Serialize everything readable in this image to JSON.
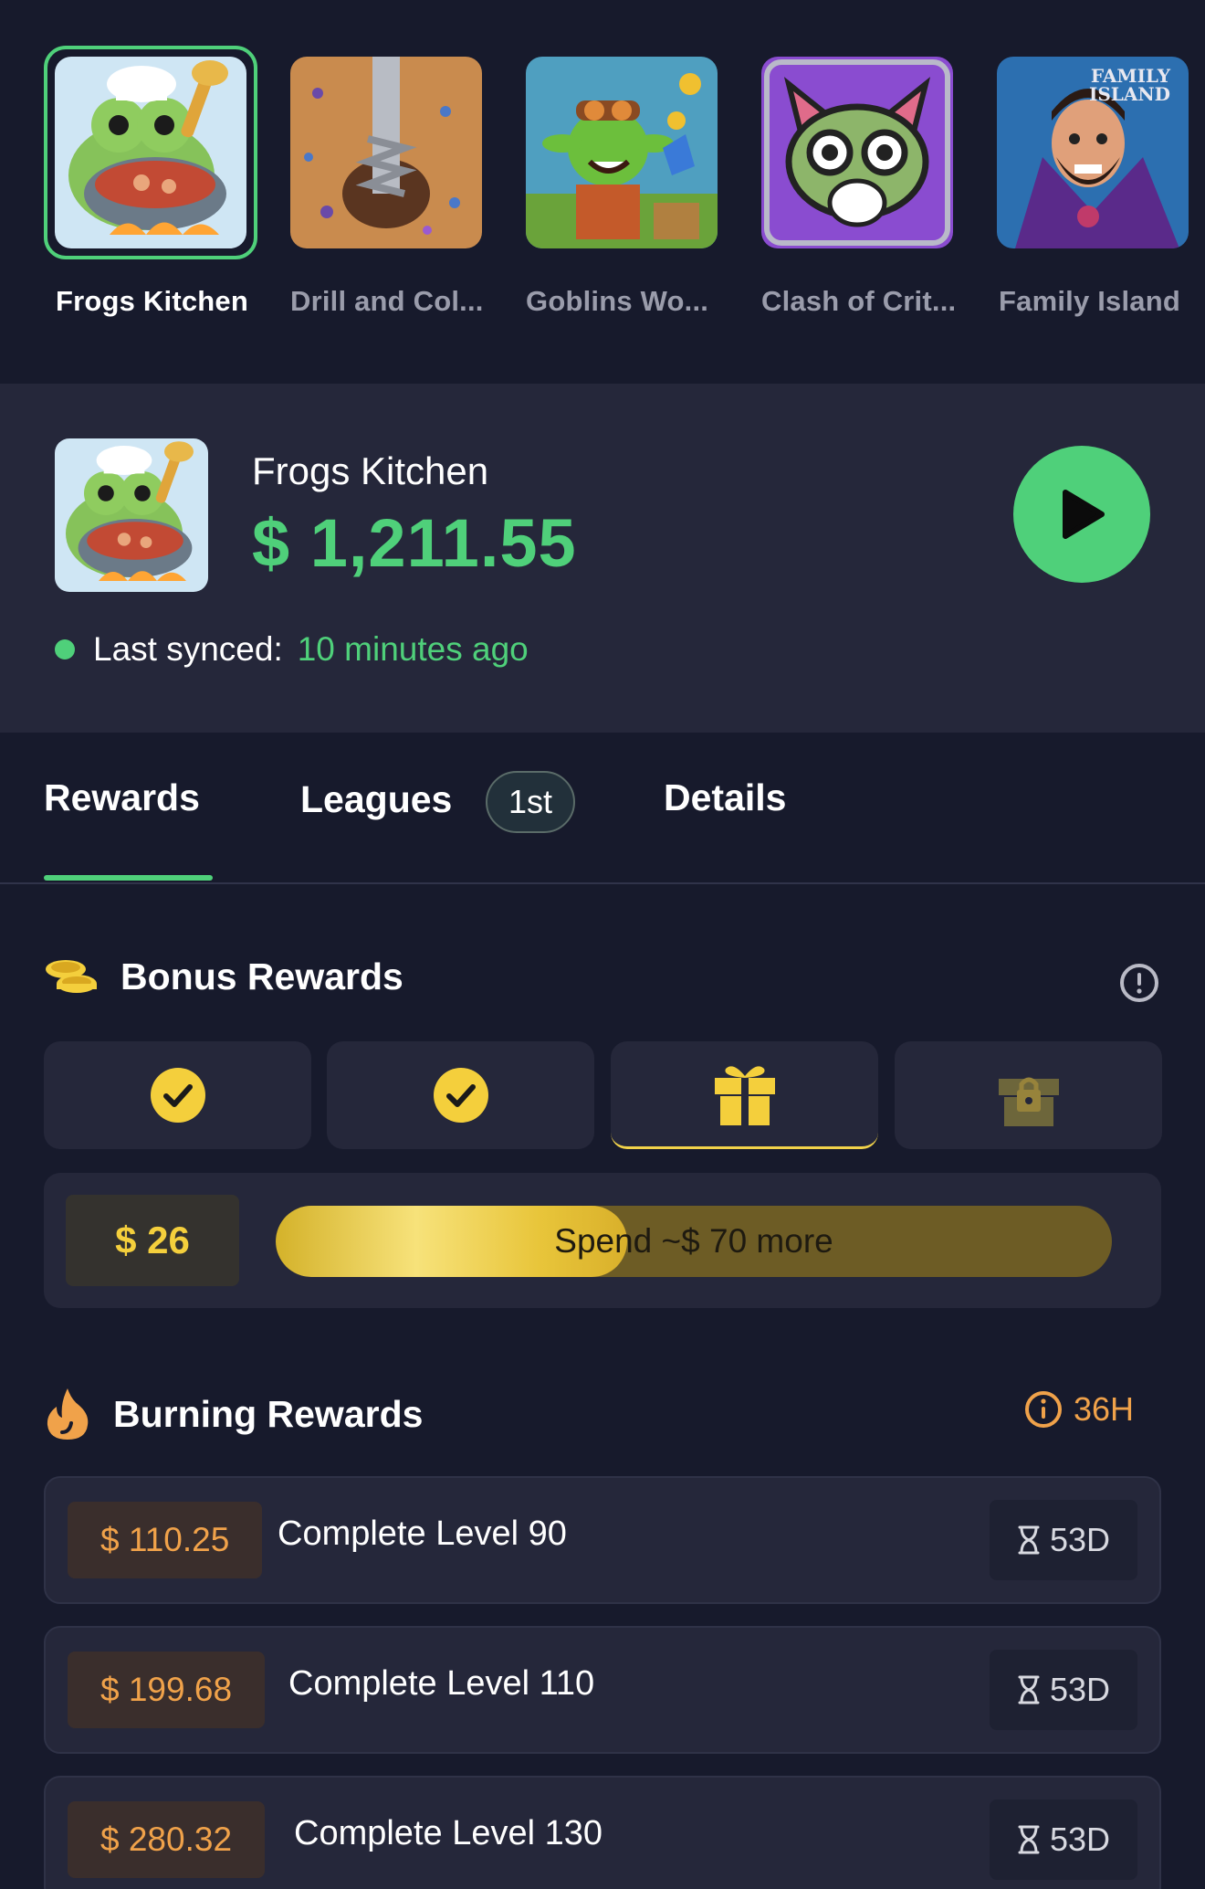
{
  "games": [
    {
      "name": "Frogs Kitchen",
      "selected": true,
      "icon": "frog-chef-icon"
    },
    {
      "name": "Drill and Col...",
      "selected": false,
      "icon": "drill-icon"
    },
    {
      "name": "Goblins Wo...",
      "selected": false,
      "icon": "goblin-icon"
    },
    {
      "name": "Clash of Crit...",
      "selected": false,
      "icon": "critter-icon"
    },
    {
      "name": "Family Island",
      "selected": false,
      "icon": "family-island-icon",
      "logo_text": "FAMILY ISLAND"
    }
  ],
  "featured": {
    "name": "Frogs Kitchen",
    "amount": "$ 1,211.55",
    "sync_label": "Last synced:",
    "sync_value": "10 minutes ago"
  },
  "tabs": {
    "rewards": "Rewards",
    "leagues": "Leagues",
    "leagues_badge": "1st",
    "details": "Details",
    "active": "rewards"
  },
  "bonus": {
    "title": "Bonus Rewards",
    "slots": [
      "claimed",
      "claimed",
      "gift-active",
      "locked"
    ],
    "amount": "$ 26",
    "progress_text": "Spend ~$ 70 more",
    "progress_fraction": 0.42
  },
  "burning": {
    "title": "Burning Rewards",
    "timer": "36H",
    "items": [
      {
        "amount": "$ 110.25",
        "task": "Complete Level 90",
        "days": "53D"
      },
      {
        "amount": "$ 199.68",
        "task": "Complete Level 110",
        "days": "53D"
      },
      {
        "amount": "$ 280.32",
        "task": "Complete Level 130",
        "days": "53D"
      }
    ]
  },
  "colors": {
    "background": "#171a2c",
    "panel": "#25273a",
    "accent_green": "#4fd07a",
    "gold": "#f4cf3c",
    "orange": "#f0a24a"
  }
}
